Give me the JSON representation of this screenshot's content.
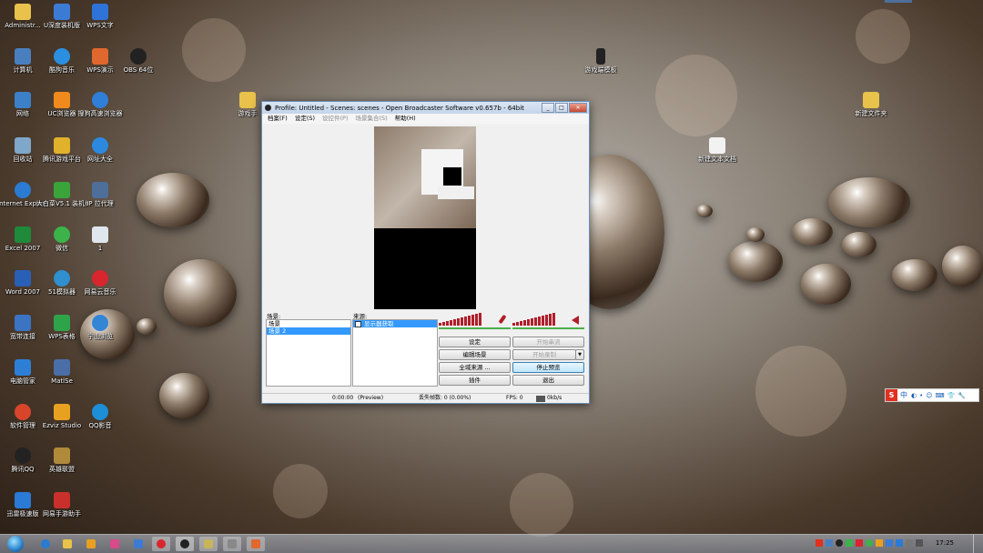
{
  "desktop": {
    "icons": [
      {
        "label": "Administr...",
        "color": "#e8c24a"
      },
      {
        "label": "U深度装机版",
        "color": "#3b7bd4"
      },
      {
        "label": "WPS文字",
        "color": "#2e73d8"
      },
      {
        "label": "计算机",
        "color": "#4a7fbf"
      },
      {
        "label": "酷狗音乐",
        "color": "#2a8fe0"
      },
      {
        "label": "WPS演示",
        "color": "#e0672d"
      },
      {
        "label": "OBS 64位",
        "color": "#222222"
      },
      {
        "label": "网络",
        "color": "#3c80c8"
      },
      {
        "label": "UC浏览器",
        "color": "#f08a1d"
      },
      {
        "label": "搜狗高速浏览器",
        "color": "#2f7fd9"
      },
      {
        "label": "回收站",
        "color": "#7fa7c9"
      },
      {
        "label": "腾讯游戏平台",
        "color": "#e0b12a"
      },
      {
        "label": "网址大全",
        "color": "#2b8ae0"
      },
      {
        "label": "Internet Explorer",
        "color": "#2a7bd1"
      },
      {
        "label": "大白菜V5.1 装机维护版",
        "color": "#3aa33a"
      },
      {
        "label": "IP 拉代理",
        "color": "#4d6f9a"
      },
      {
        "label": "Excel 2007",
        "color": "#1f8a3a"
      },
      {
        "label": "微信",
        "color": "#3bb34a"
      },
      {
        "label": "1",
        "color": "#dfe6ee"
      },
      {
        "label": "Word 2007",
        "color": "#2a5fb8"
      },
      {
        "label": "51模拟器",
        "color": "#2f8fcf"
      },
      {
        "label": "网易云音乐",
        "color": "#d8262f"
      },
      {
        "label": "宽带连接",
        "color": "#3a74c2"
      },
      {
        "label": "WPS表格",
        "color": "#2fa34a"
      },
      {
        "label": "宁山浏览",
        "color": "#3385d6"
      },
      {
        "label": "电脑管家",
        "color": "#2d7fd6"
      },
      {
        "label": "MatlSe",
        "color": "#4a6fa8"
      },
      {
        "label": "软件管理",
        "color": "#d9452a"
      },
      {
        "label": "Ezviz Studio",
        "color": "#e8a020"
      },
      {
        "label": "QQ影音",
        "color": "#1d8fd8"
      },
      {
        "label": "腾讯QQ",
        "color": "#222222"
      },
      {
        "label": "英雄联盟",
        "color": "#b08a3a"
      },
      {
        "label": "迅雷极速版",
        "color": "#2a7ad6"
      },
      {
        "label": "网易手游助手",
        "color": "#c9302c"
      },
      {
        "label": "游戏手",
        "color": "#e8c24a"
      },
      {
        "label": "游戏端模板",
        "color": "#222222"
      },
      {
        "label": "新建文件夹",
        "color": "#e8c24a"
      },
      {
        "label": "新建文本文档",
        "color": "#f2f2f2"
      }
    ]
  },
  "obs": {
    "title": "Profile: Untitled - Scenes: scenes - Open Broadcaster Software v0.657b - 64bit",
    "menu": [
      {
        "label": "档案(F)",
        "dim": false
      },
      {
        "label": "设定(S)",
        "dim": false
      },
      {
        "label": "设控件(P)",
        "dim": true
      },
      {
        "label": "场景集合(S)",
        "dim": true
      },
      {
        "label": "帮助(H)",
        "dim": false
      }
    ],
    "scenes_label": "场景:",
    "scenes": [
      "场景",
      "场景 2"
    ],
    "sources_label": "来源:",
    "sources": [
      "显示器获取"
    ],
    "buttons": {
      "settings": "设定",
      "edit_scene": "编辑场景",
      "global_sources": "全域来源 ...",
      "plugins": "插件",
      "start_streaming": "开始串流",
      "start_recording": "开始录制",
      "stop_preview": "停止预览",
      "exit": "退出"
    },
    "status": {
      "time": "0:00:00",
      "mode": "(Preview)",
      "dropped": "丢失帧数: 0 (0.00%)",
      "fps": "FPS: 0",
      "bitrate": "0kb/s"
    }
  },
  "taskbar": {
    "clock": "17:25",
    "ime_label": "中"
  }
}
